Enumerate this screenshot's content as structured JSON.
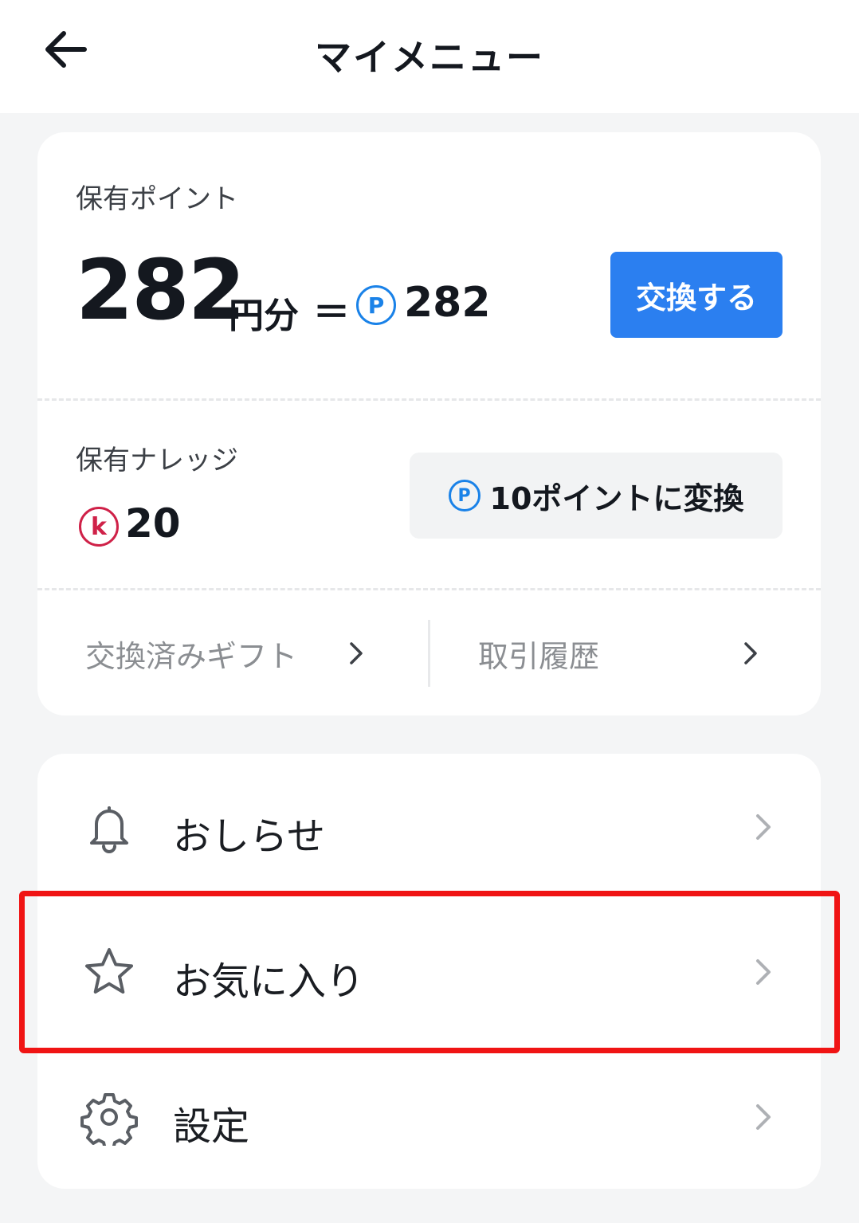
{
  "header": {
    "title": "マイメニュー",
    "back_icon": "back-arrow-icon"
  },
  "points": {
    "label": "保有ポイント",
    "amount": "282",
    "unit": "円分",
    "equals": "＝",
    "p_symbol": "P",
    "p_value": "282",
    "exchange_button": "交換する"
  },
  "knowledge": {
    "label": "保有ナレッジ",
    "k_symbol": "k",
    "k_value": "20",
    "convert_button": "10ポイントに変換"
  },
  "links": {
    "gifts": "交換済みギフト",
    "history": "取引履歴"
  },
  "menu": {
    "items": [
      {
        "label": "おしらせ",
        "icon": "bell-icon"
      },
      {
        "label": "お気に入り",
        "icon": "star-icon"
      },
      {
        "label": "設定",
        "icon": "gear-icon"
      }
    ]
  },
  "colors": {
    "accent_blue": "#2b7ff0",
    "point_blue": "#1a82e8",
    "knowledge_red": "#cf2148",
    "highlight_red": "#f01414"
  }
}
